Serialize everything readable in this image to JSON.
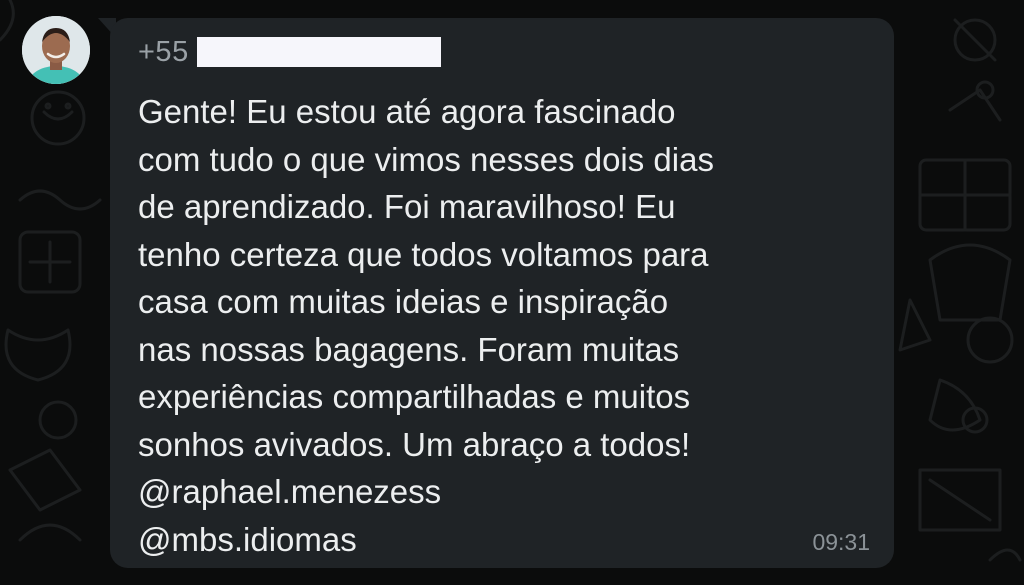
{
  "sender": {
    "country_code": "+55"
  },
  "message": {
    "lines": [
      "Gente! Eu estou até agora fascinado",
      "com tudo o que vimos nesses dois dias",
      "de aprendizado. Foi maravilhoso! Eu",
      "tenho certeza que todos voltamos para",
      "casa com muitas ideias e inspiração",
      "nas nossas bagagens. Foram muitas",
      "experiências compartilhadas e muitos",
      "sonhos avivados. Um abraço a todos!",
      "@raphael.menezess",
      "@mbs.idiomas"
    ],
    "time": "09:31"
  },
  "colors": {
    "chat_background": "#0b0c0c",
    "bubble": "#1f2326",
    "message_text": "#eceeef",
    "meta_text": "#8b9297",
    "redaction": "#f6f6fb"
  },
  "icons": {
    "avatar": "avatar"
  }
}
